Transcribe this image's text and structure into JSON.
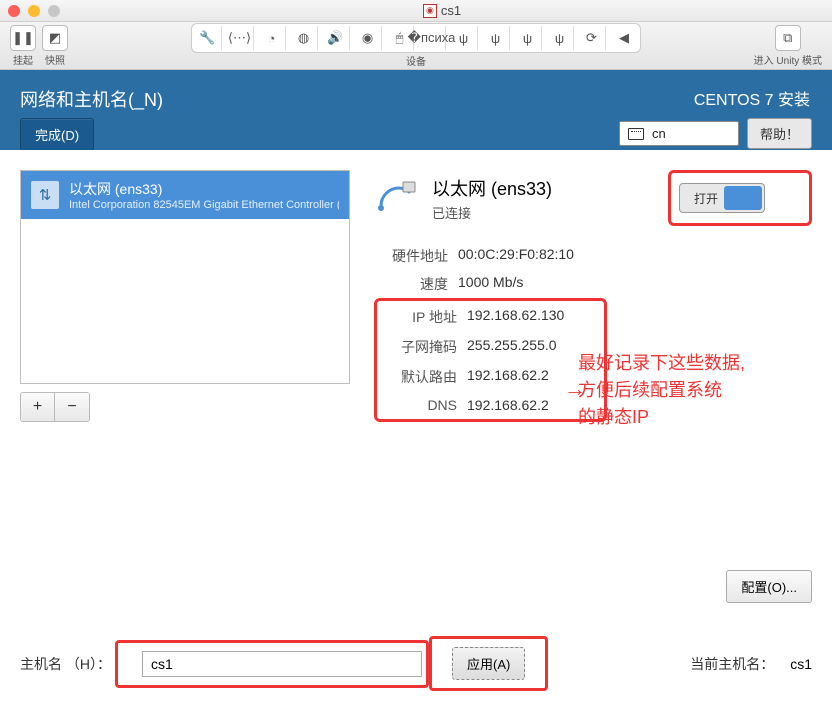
{
  "window": {
    "title": "cs1"
  },
  "vm_toolbar": {
    "suspend_label": "挂起",
    "snapshot_label": "快照",
    "devices_label": "设备",
    "unity_label": "进入 Unity 模式"
  },
  "installer": {
    "section_title": "网络和主机名(_N)",
    "done_label": "完成(D)",
    "product": "CENTOS 7 安装",
    "lang": "cn",
    "help_label": "帮助！"
  },
  "network": {
    "item_name": "以太网 (ens33)",
    "item_sub": "Intel Corporation 82545EM Gigabit Ethernet Controller (",
    "add_symbol": "+",
    "remove_symbol": "−"
  },
  "details": {
    "title": "以太网 (ens33)",
    "status": "已连接",
    "toggle_label": "打开",
    "hw_label": "硬件地址",
    "hw_value": "00:0C:29:F0:82:10",
    "speed_label": "速度",
    "speed_value": "1000 Mb/s",
    "ip_label": "IP 地址",
    "ip_value": "192.168.62.130",
    "mask_label": "子网掩码",
    "mask_value": "255.255.255.0",
    "gw_label": "默认路由",
    "gw_value": "192.168.62.2",
    "dns_label": "DNS",
    "dns_value": "192.168.62.2",
    "config_label": "配置(O)..."
  },
  "annotation": {
    "line1": "最好记录下这些数据,",
    "line2": "方便后续配置系统",
    "line3": "的静态IP"
  },
  "hostname": {
    "label": "主机名 （H）：",
    "value": "cs1",
    "apply_label": "应用(A)",
    "current_label": "当前主机名：",
    "current_value": "cs1"
  }
}
